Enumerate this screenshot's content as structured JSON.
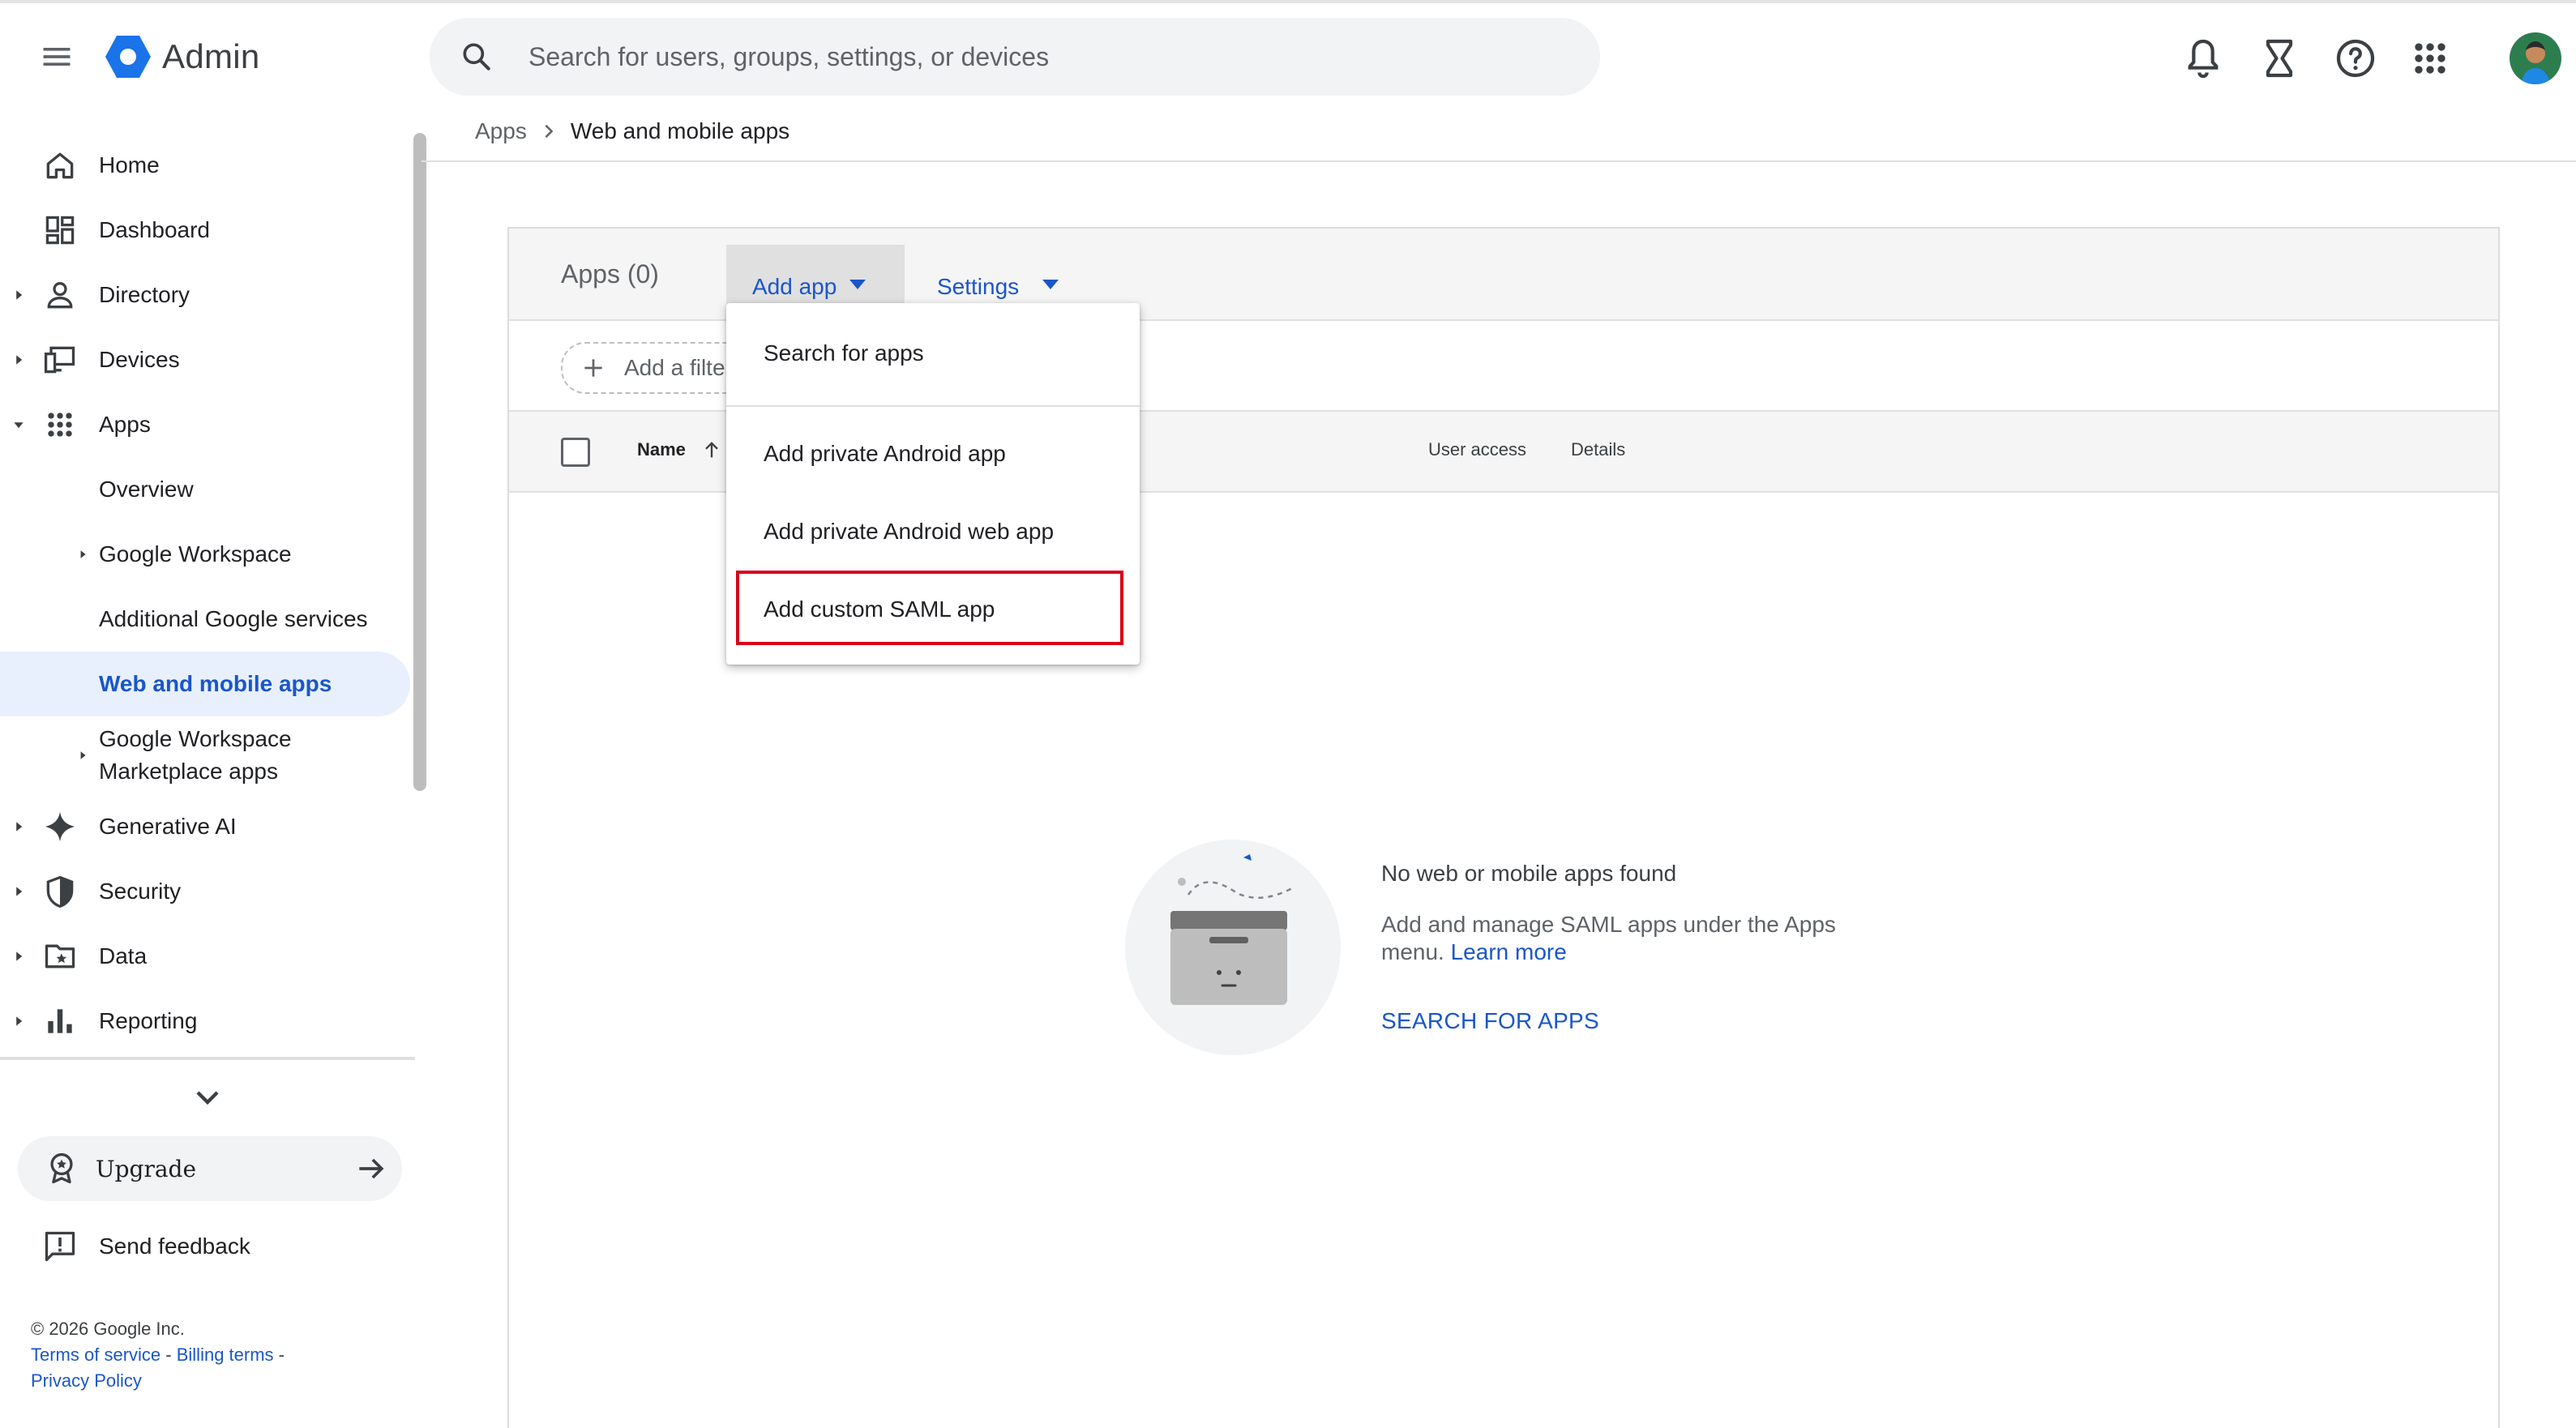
{
  "header": {
    "app_name": "Admin",
    "search_placeholder": "Search for users, groups, settings, or devices",
    "icons": [
      "menu-icon",
      "admin-logo-icon",
      "search-icon",
      "notifications-icon",
      "tasks-hourglass-icon",
      "help-icon",
      "apps-grid-icon",
      "avatar"
    ]
  },
  "sidebar": {
    "items": [
      {
        "label": "Home",
        "icon": "home-icon"
      },
      {
        "label": "Dashboard",
        "icon": "dashboard-icon"
      },
      {
        "label": "Directory",
        "icon": "person-icon"
      },
      {
        "label": "Devices",
        "icon": "devices-icon"
      },
      {
        "label": "Apps",
        "icon": "apps-grid-icon"
      },
      {
        "label": "Overview"
      },
      {
        "label": "Google Workspace"
      },
      {
        "label": "Additional Google services"
      },
      {
        "label": "Web and mobile apps"
      },
      {
        "label_line1": "Google Workspace",
        "label_line2": "Marketplace apps"
      },
      {
        "label": "Generative AI",
        "icon": "sparkle-icon"
      },
      {
        "label": "Security",
        "icon": "shield-icon"
      },
      {
        "label": "Data",
        "icon": "folder-star-icon"
      },
      {
        "label": "Reporting",
        "icon": "bar-chart-icon"
      }
    ],
    "upgrade_label": "Upgrade",
    "feedback_label": "Send feedback",
    "footer": {
      "copyright": "© 2026 Google Inc.",
      "terms": "Terms of service",
      "billing": "Billing terms",
      "dash": "-",
      "privacy": "Privacy Policy"
    }
  },
  "breadcrumb": {
    "parent": "Apps",
    "current": "Web and mobile apps"
  },
  "card": {
    "apps_count": "Apps (0)",
    "add_app_label": "Add app",
    "settings_label": "Settings",
    "filter_label": "Add a filter",
    "columns": {
      "name": "Name",
      "user_access": "User access",
      "details": "Details"
    }
  },
  "dropdown": {
    "items": [
      {
        "label": "Search for apps"
      },
      {
        "label": "Add private Android app"
      },
      {
        "label": "Add private Android web app"
      },
      {
        "label": "Add custom SAML app"
      }
    ],
    "highlight_color": "#d9001b"
  },
  "empty_state": {
    "title": "No web or mobile apps found",
    "description": "Add and manage SAML apps under the Apps menu.",
    "learn_more": "Learn more",
    "action": "SEARCH FOR APPS"
  },
  "colors": {
    "accent": "#1a56c9",
    "active_bg": "#e8f0fe",
    "highlight": "#d9001b"
  }
}
